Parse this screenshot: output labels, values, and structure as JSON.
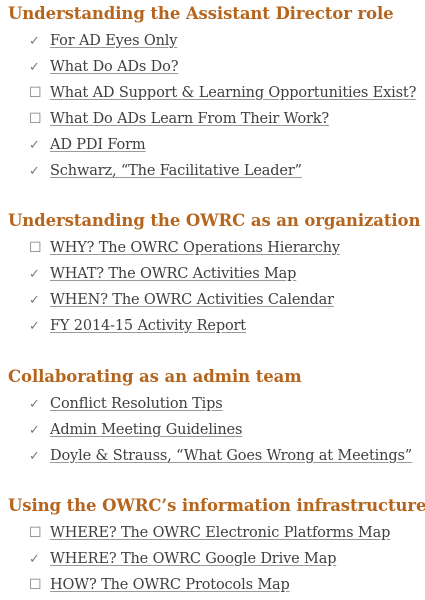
{
  "sections": [
    {
      "title": "Understanding the Assistant Director role",
      "items": [
        {
          "mark": "✓",
          "label": "For AD Eyes Only"
        },
        {
          "mark": "✓",
          "label": "What Do ADs Do?"
        },
        {
          "mark": "☐",
          "label": "What AD Support & Learning Opportunities Exist?"
        },
        {
          "mark": "☐",
          "label": "What Do ADs Learn From Their Work?"
        },
        {
          "mark": "✓",
          "label": "AD PDI Form"
        },
        {
          "mark": "✓",
          "label": "Schwarz, “The Facilitative Leader”"
        }
      ]
    },
    {
      "title": "Understanding the OWRC as an organization",
      "items": [
        {
          "mark": "☐",
          "label": "WHY? The OWRC Operations Hierarchy"
        },
        {
          "mark": "✓",
          "label": "WHAT? The OWRC Activities Map"
        },
        {
          "mark": "✓",
          "label": "WHEN? The OWRC Activities Calendar"
        },
        {
          "mark": "✓",
          "label": "FY 2014-15 Activity Report"
        }
      ]
    },
    {
      "title": "Collaborating as an admin team",
      "items": [
        {
          "mark": "✓",
          "label": "Conflict Resolution Tips"
        },
        {
          "mark": "✓",
          "label": "Admin Meeting Guidelines"
        },
        {
          "mark": "✓",
          "label": "Doyle & Strauss, “What Goes Wrong at Meetings”"
        }
      ]
    },
    {
      "title": "Using the OWRC’s information infrastructure",
      "items": [
        {
          "mark": "☐",
          "label": "WHERE? The OWRC Electronic Platforms Map"
        },
        {
          "mark": "✓",
          "label": "WHERE? The OWRC Google Drive Map"
        },
        {
          "mark": "☐",
          "label": "HOW? The OWRC Protocols Map"
        }
      ]
    }
  ],
  "colors": {
    "heading": "#b5651d",
    "link_text": "#3f3f3f",
    "mark": "#7a7a7a"
  }
}
